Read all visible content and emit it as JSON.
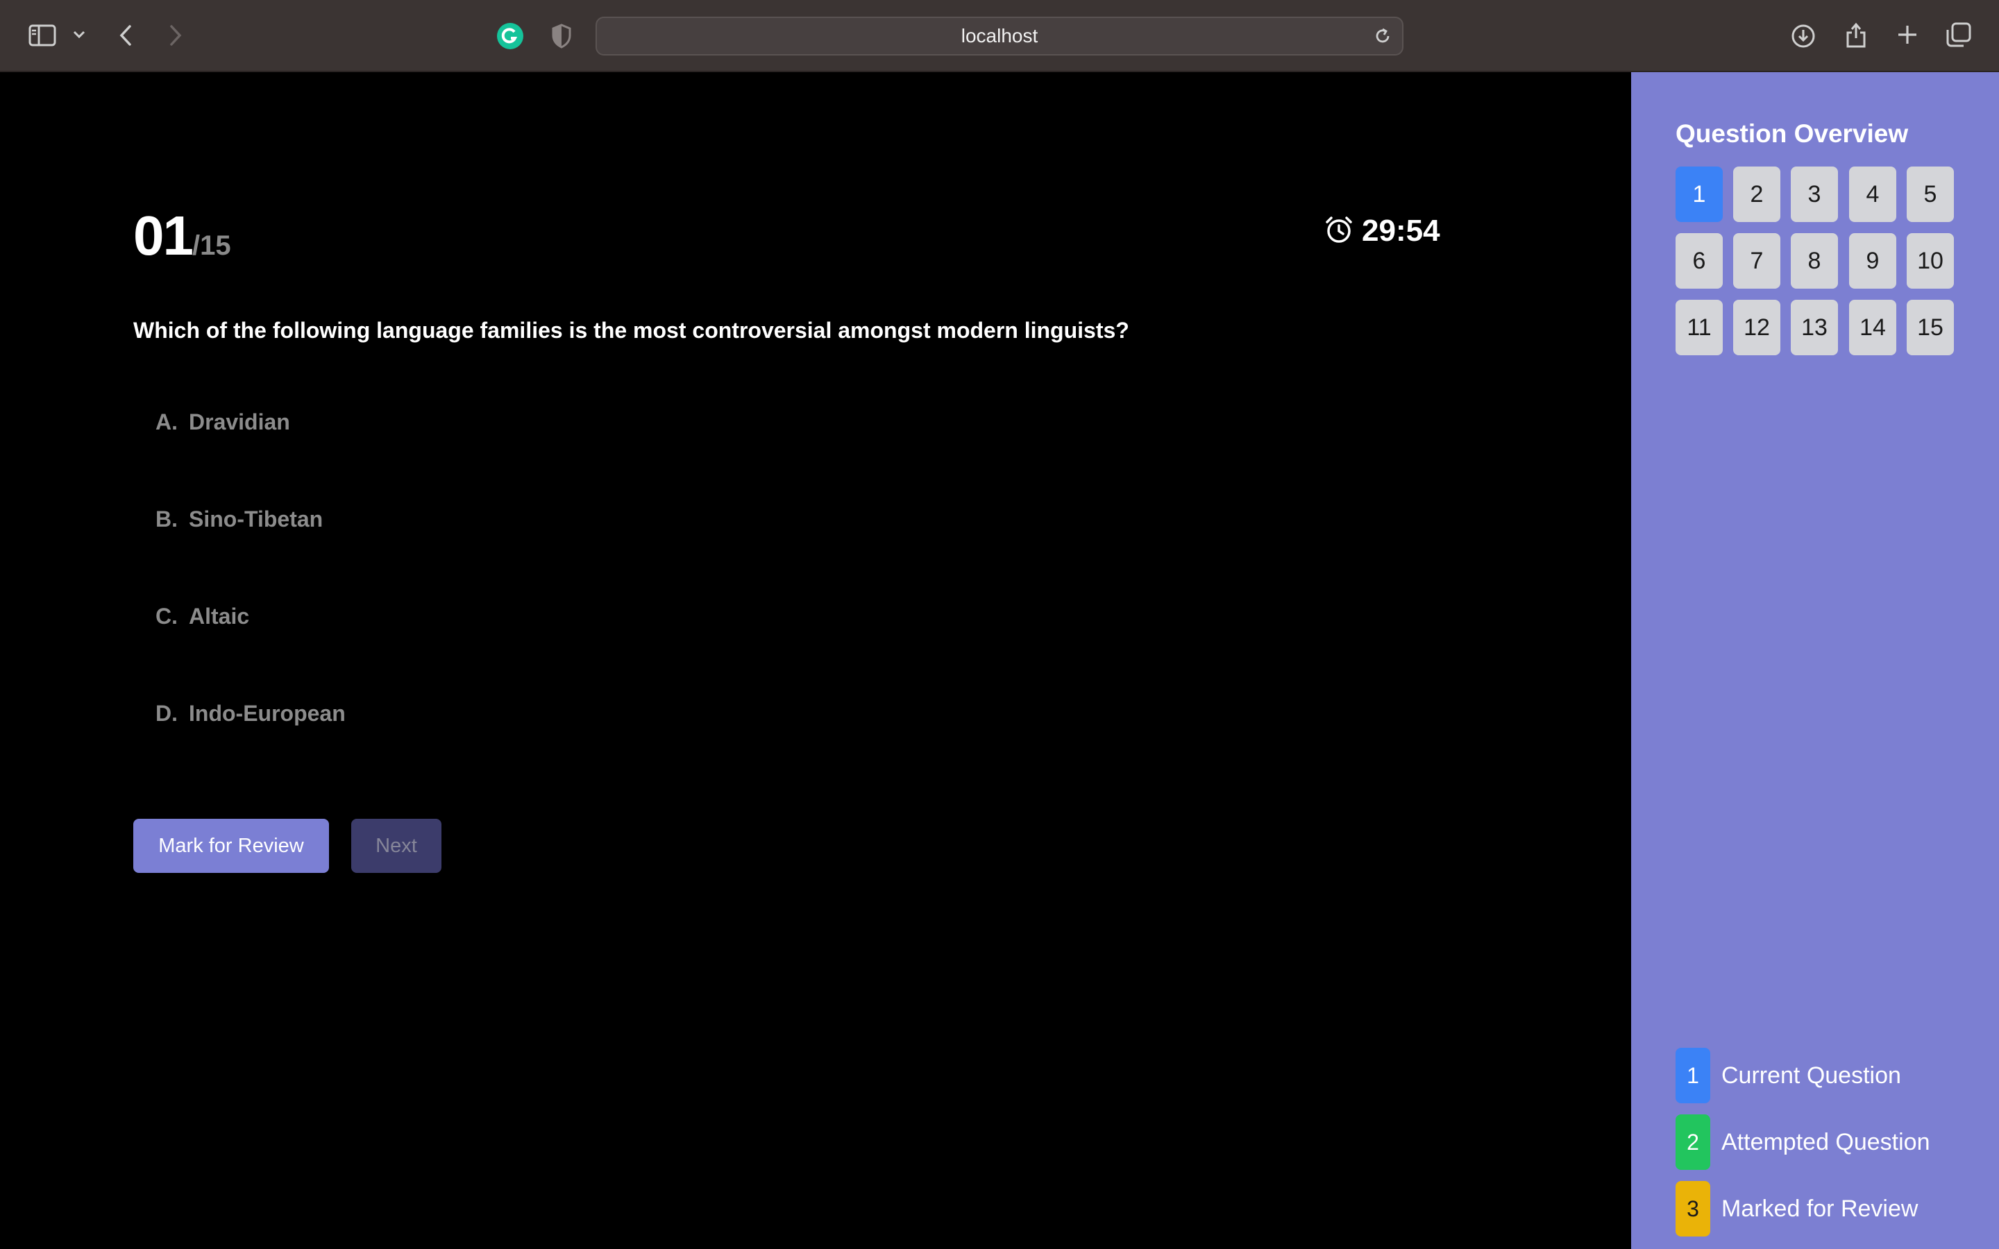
{
  "browser": {
    "url": "localhost"
  },
  "quiz": {
    "current_number": "01",
    "total": "/15",
    "timer": "29:54",
    "question": "Which of the following language families is the most controversial amongst modern linguists?",
    "options": [
      {
        "letter": "A.",
        "text": "Dravidian"
      },
      {
        "letter": "B.",
        "text": "Sino-Tibetan"
      },
      {
        "letter": "C.",
        "text": "Altaic"
      },
      {
        "letter": "D.",
        "text": "Indo-European"
      }
    ],
    "buttons": {
      "mark_review": "Mark for Review",
      "next": "Next"
    }
  },
  "overview": {
    "title": "Question Overview",
    "questions": [
      "1",
      "2",
      "3",
      "4",
      "5",
      "6",
      "7",
      "8",
      "9",
      "10",
      "11",
      "12",
      "13",
      "14",
      "15"
    ],
    "current_index": 0,
    "legend": [
      {
        "num": "1",
        "label": "Current Question",
        "color": "#3b82f6"
      },
      {
        "num": "2",
        "label": "Attempted Question",
        "color": "#22c55e"
      },
      {
        "num": "3",
        "label": "Marked for Review",
        "color": "#eab308"
      }
    ]
  },
  "colors": {
    "accent": "#7b7fd4",
    "sidebar_bg": "#7c7fd2",
    "current_blue": "#3b82f6",
    "attempted_green": "#22c55e",
    "review_yellow": "#eab308"
  }
}
